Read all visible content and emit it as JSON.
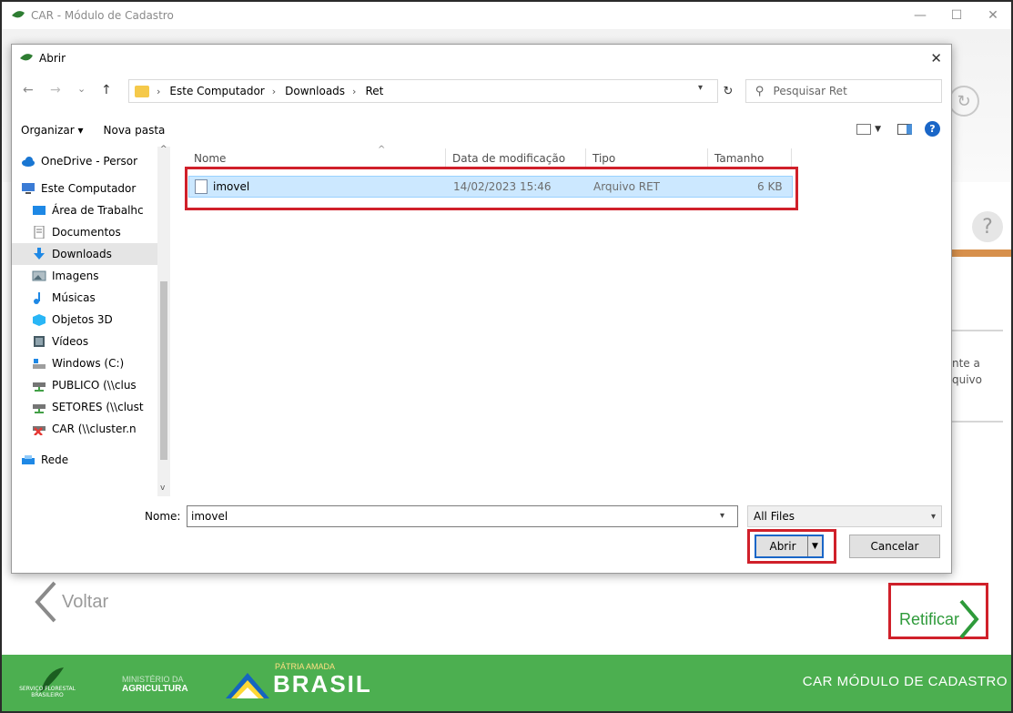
{
  "app": {
    "title": "CAR - Módulo de Cadastro",
    "minimize_glyph": "—",
    "maximize_glyph": "☐",
    "close_glyph": "✕"
  },
  "dialog": {
    "title": "Abrir",
    "close_glyph": "✕",
    "nav": {
      "back": "←",
      "forward": "→",
      "recent": "⌄",
      "up": "↑"
    },
    "breadcrumb": [
      "Este Computador",
      "Downloads",
      "Ret"
    ],
    "crumb_sep": "›",
    "search_placeholder": "Pesquisar Ret",
    "toolbar": {
      "organize": "Organizar ▾",
      "new_folder": "Nova pasta",
      "help": "?"
    },
    "nav_pane": [
      {
        "label": "OneDrive - Persor",
        "icon": "cloud-icon"
      },
      {
        "label": "Este Computador",
        "icon": "computer-icon"
      },
      {
        "label": "Área de Trabalhc",
        "icon": "desktop-icon"
      },
      {
        "label": "Documentos",
        "icon": "document-icon"
      },
      {
        "label": "Downloads",
        "icon": "download-icon"
      },
      {
        "label": "Imagens",
        "icon": "image-icon"
      },
      {
        "label": "Músicas",
        "icon": "music-icon"
      },
      {
        "label": "Objetos 3D",
        "icon": "cube-icon"
      },
      {
        "label": "Vídeos",
        "icon": "video-icon"
      },
      {
        "label": "Windows (C:)",
        "icon": "drive-icon"
      },
      {
        "label": "PUBLICO (\\\\clus",
        "icon": "network-drive-icon"
      },
      {
        "label": "SETORES (\\\\clust",
        "icon": "network-drive-icon"
      },
      {
        "label": "CAR (\\\\cluster.n",
        "icon": "network-drive-disconnected-icon"
      },
      {
        "label": "Rede",
        "icon": "network-icon"
      }
    ],
    "selected_nav": "Downloads",
    "columns": [
      "Nome",
      "Data de modificação",
      "Tipo",
      "Tamanho"
    ],
    "files": [
      {
        "name": "imovel",
        "modified": "14/02/2023 15:46",
        "type": "Arquivo RET",
        "size": "6 KB"
      }
    ],
    "name_label": "Nome:",
    "name_value": "imovel",
    "filter_value": "All Files",
    "open_button": "Abrir",
    "cancel_button": "Cancelar"
  },
  "background": {
    "help": "?",
    "refresh": "↻",
    "side_text": [
      "nte a",
      "quivo"
    ],
    "back_button": "Voltar",
    "rectify_button": "Retificar"
  },
  "footer": {
    "sfb_text": "SERVIÇO FLORESTAL BRASILEIRO",
    "ministry_line1": "MINISTÉRIO DA",
    "ministry_line2": "AGRICULTURA",
    "patria": "PÁTRIA AMADA",
    "brasil": "BRASIL",
    "right_text": "CAR MÓDULO DE CADASTRO"
  },
  "colors": {
    "highlight_red": "#d0202a",
    "footer_green": "#4caf50",
    "selection_blue": "#cce8ff",
    "retificar_green": "#2e9a3a"
  }
}
